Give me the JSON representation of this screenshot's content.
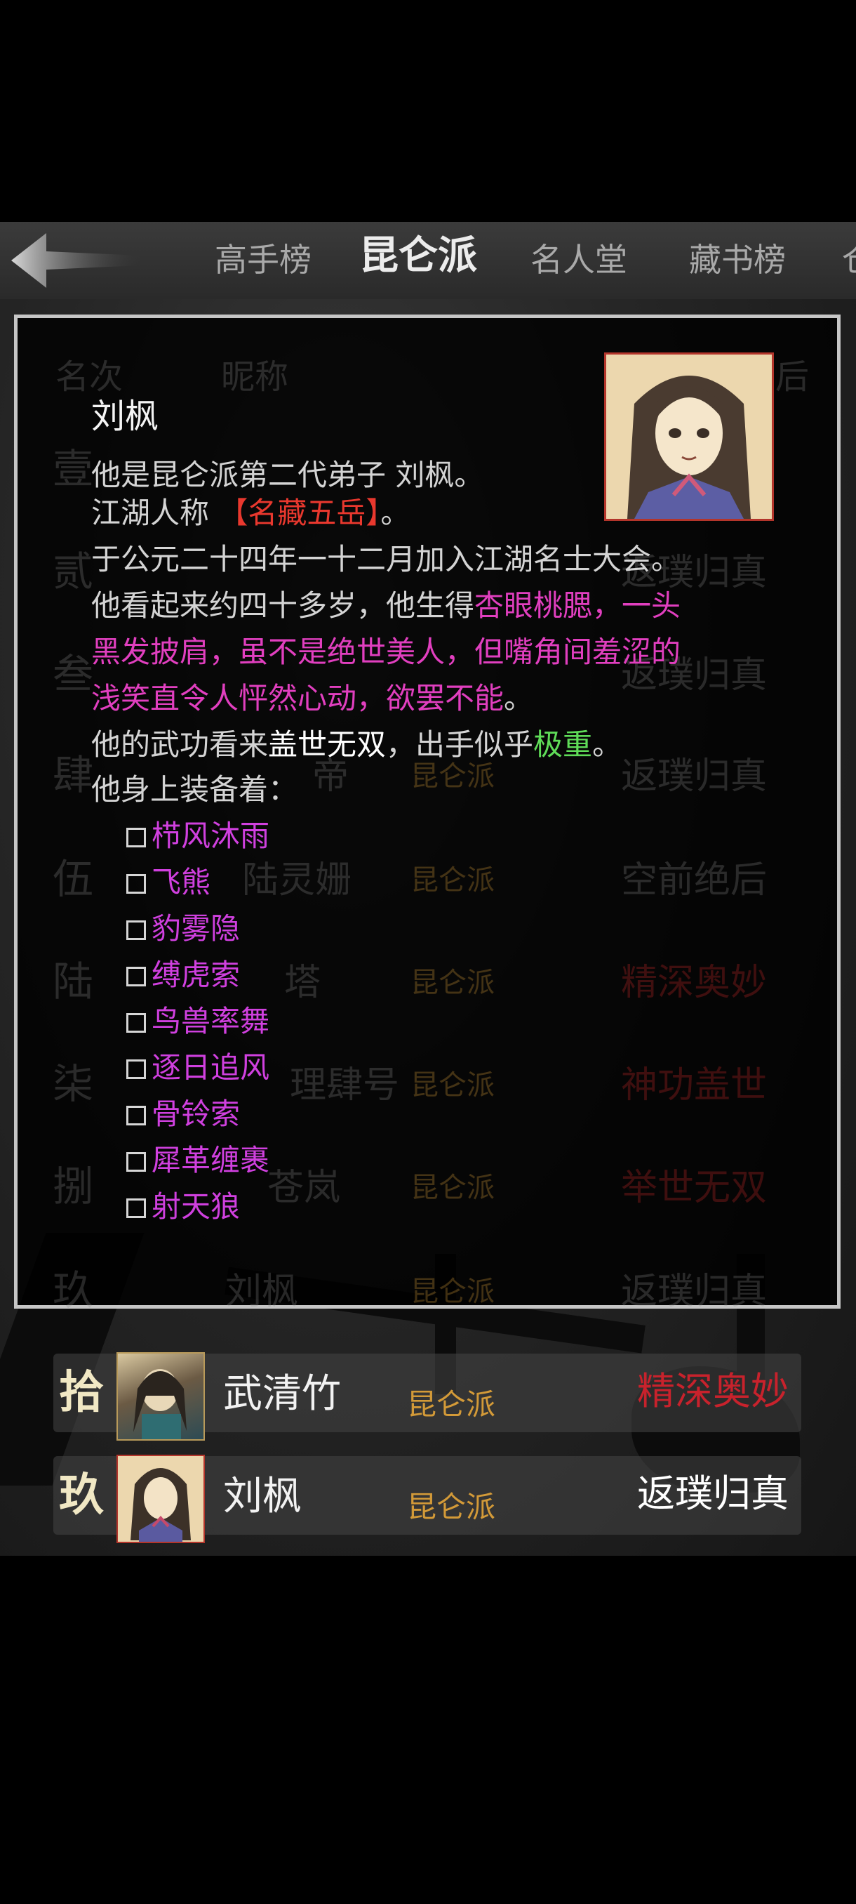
{
  "tabs": [
    {
      "label": "高手榜"
    },
    {
      "label": "昆仑派",
      "active": true
    },
    {
      "label": "名人堂"
    },
    {
      "label": "藏书榜"
    },
    {
      "label": "仓"
    }
  ],
  "list_header": {
    "col_rank": "名次",
    "col_name": "昵称",
    "col_title": "后"
  },
  "background_rows": [
    {
      "rank": "壹",
      "name": "",
      "sect": "",
      "title": ""
    },
    {
      "rank": "贰",
      "name": "",
      "sect": "",
      "title": "返璞归真"
    },
    {
      "rank": "叁",
      "name": "",
      "sect": "",
      "title": "返璞归真"
    },
    {
      "rank": "肆",
      "name": "帝",
      "sect": "昆仑派",
      "title": "返璞归真"
    },
    {
      "rank": "伍",
      "name": "陆灵姗",
      "sect": "昆仑派",
      "title": "空前绝后"
    },
    {
      "rank": "陆",
      "name": "塔",
      "sect": "昆仑派",
      "title": "精深奥妙"
    },
    {
      "rank": "柒",
      "name": "理肆号",
      "sect": "昆仑派",
      "title": "神功盖世"
    },
    {
      "rank": "捌",
      "name": "苍岚",
      "sect": "昆仑派",
      "title": "举世无双"
    },
    {
      "rank": "玖",
      "name": "刘枫",
      "sect": "昆仑派",
      "title": "返璞归真"
    }
  ],
  "visible_rows": [
    {
      "rank": "拾",
      "name": "武清竹",
      "sect": "昆仑派",
      "title": "精深奥妙",
      "title_color": "#c8222c"
    },
    {
      "rank": "玖",
      "name": "刘枫",
      "sect": "昆仑派",
      "title": "返璞归真",
      "title_color": "#ffffff"
    }
  ],
  "profile": {
    "name": "刘枫",
    "line1": "他是昆仑派第二代弟子 刘枫。",
    "line2_prefix": "江湖人称 ",
    "nickname": "【名藏五岳】",
    "line2_suffix": "。",
    "line3": "于公元二十四年一十二月加入江湖名士大会。",
    "line4_prefix": "他看起来约四十多岁，他生得",
    "appearance_a": "杏眼桃腮，一头",
    "appearance_b": "黑发披肩，虽不是绝世美人，但嘴角间羞涩的",
    "appearance_c": "浅笑直令人怦然心动，欲罢不能",
    "line6_suffix": "。",
    "line7_prefix": "他的武功看来",
    "martial_level": "盖世无双",
    "line7_mid": "，出手似乎",
    "hit_level": "极重",
    "line7_suffix": "。",
    "equip_header": "他身上装备着：",
    "equipment": [
      "栉风沐雨",
      "飞熊",
      "豹雾隐",
      "缚虎索",
      "鸟兽率舞",
      "逐日追风",
      "骨铃索",
      "犀革缠裹",
      "射天狼"
    ]
  },
  "colors": {
    "nickname": "#e9382e",
    "appearance": "#e13fbf",
    "equipment": "#d040df",
    "hit_level": "#5fdc58",
    "sect": "#d39a38"
  }
}
